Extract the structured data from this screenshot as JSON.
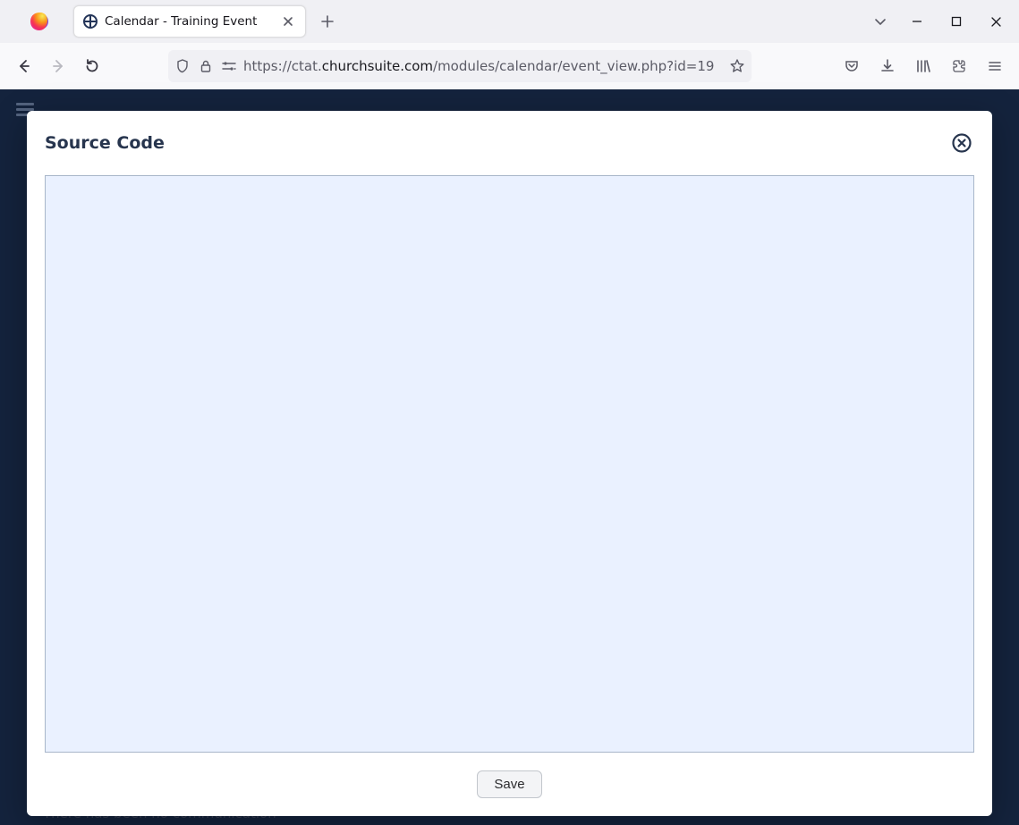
{
  "browser": {
    "tab_title": "Calendar - Training Event",
    "url_prefix": "https://ctat.",
    "url_bold": "churchsuite.com",
    "url_rest": "/modules/calendar/event_view.php?id=19"
  },
  "modal": {
    "title": "Source Code",
    "textarea_value": "",
    "save_label": "Save"
  },
  "background": {
    "text": "There has been no communication"
  }
}
